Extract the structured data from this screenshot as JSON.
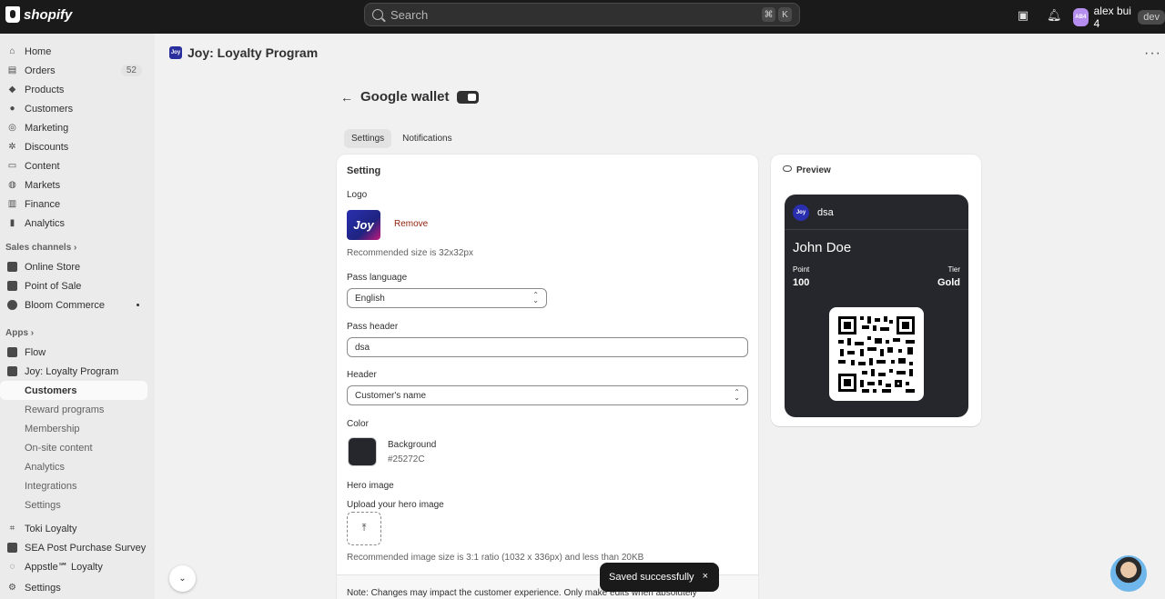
{
  "topbar": {
    "brand": "shopify",
    "search_placeholder": "Search",
    "kbd1": "⌘",
    "kbd2": "K",
    "user_initials": "AB4",
    "user_name": "alex bui 4",
    "user_badge": "dev"
  },
  "sidebar": {
    "items": [
      {
        "label": "Home"
      },
      {
        "label": "Orders",
        "badge": "52"
      },
      {
        "label": "Products"
      },
      {
        "label": "Customers"
      },
      {
        "label": "Marketing"
      },
      {
        "label": "Discounts"
      },
      {
        "label": "Content"
      },
      {
        "label": "Markets"
      },
      {
        "label": "Finance"
      },
      {
        "label": "Analytics"
      }
    ],
    "sales_channels_heading": "Sales channels",
    "sales_channels": [
      "Online Store",
      "Point of Sale",
      "Bloom Commerce"
    ],
    "apps_heading": "Apps",
    "apps": [
      "Flow",
      "Joy: Loyalty Program"
    ],
    "joy_sub": [
      "Customers",
      "Reward programs",
      "Membership",
      "On-site content",
      "Analytics",
      "Integrations",
      "Settings"
    ],
    "more_apps": [
      "Toki Loyalty",
      "SEA Post Purchase Survey",
      "Appstle℠ Loyalty"
    ],
    "settings": "Settings"
  },
  "header": {
    "app_logo_text": "Joy",
    "app_title": "Joy: Loyalty Program",
    "more": "···"
  },
  "page": {
    "title": "Google wallet",
    "tabs": [
      "Settings",
      "Notifications"
    ],
    "active_tab": "Settings"
  },
  "settings": {
    "section_title": "Setting",
    "logo_label": "Logo",
    "logo_text": "Joy",
    "remove_label": "Remove",
    "logo_hint": "Recommended size is 32x32px",
    "pass_language_label": "Pass language",
    "pass_language_value": "English",
    "pass_header_label": "Pass header",
    "pass_header_value": "dsa",
    "header_label": "Header",
    "header_value": "Customer's name",
    "color_label": "Color",
    "background_label": "Background",
    "background_value": "#25272C",
    "hero_label": "Hero image",
    "hero_upload_label": "Upload your hero image",
    "hero_hint": "Recommended image size is 3:1 ratio (1032 x 336px) and less than 20KB",
    "note": "Note: Changes may impact the customer experience. Only make edits when absolutely"
  },
  "preview": {
    "title": "Preview",
    "pass_logo_text": "Joy",
    "pass_header": "dsa",
    "name": "John Doe",
    "point_label": "Point",
    "point_value": "100",
    "tier_label": "Tier",
    "tier_value": "Gold"
  },
  "toast": {
    "message": "Saved successfully",
    "close": "×"
  },
  "colors": {
    "pass_background": "#25272C",
    "topbar": "#1a1a1a",
    "accent_remove": "#8e1f0b"
  }
}
